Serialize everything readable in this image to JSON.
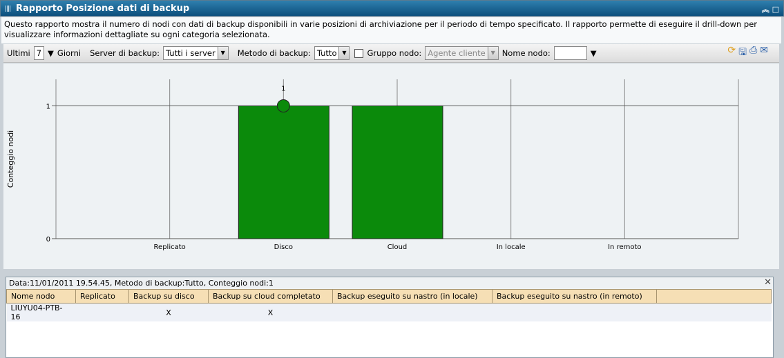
{
  "window": {
    "title": "Rapporto Posizione dati di backup",
    "collapse_icon": "double-chevron-up",
    "maximize_icon": "square"
  },
  "description": "Questo rapporto mostra il numero di nodi con dati di backup disponibili in varie posizioni di archiviazione per il periodo di tempo specificato. Il rapporto permette di eseguire il drill-down per visualizzare informazioni dettagliate su ogni categoria selezionata.",
  "filters": {
    "last_label": "Ultimi",
    "days_value": "7",
    "days_label": "Giorni",
    "server_label": "Server di backup:",
    "server_value": "Tutti i server",
    "method_label": "Metodo di backup:",
    "method_value": "Tutto",
    "group_label": "Gruppo nodo:",
    "group_value": "Agente cliente",
    "group_checked": false,
    "node_label": "Nome nodo:",
    "node_value": ""
  },
  "actions": [
    "refresh-icon",
    "save-icon",
    "print-icon",
    "email-icon"
  ],
  "chart_data": {
    "type": "bar",
    "categories": [
      "Replicato",
      "Disco",
      "Cloud",
      "In locale",
      "In remoto"
    ],
    "values": [
      0,
      1,
      1,
      0,
      0
    ],
    "ylabel": "Conteggio nodi",
    "xlabel": "",
    "yticks": [
      "0",
      "1"
    ],
    "ylim": [
      0,
      1.2
    ],
    "grid": true,
    "bar_color": "#0b8a0b",
    "selected_point": {
      "category": "Disco",
      "value": 1,
      "label": "1"
    }
  },
  "detail": {
    "header": "Data:11/01/2011 19.54.45, Metodo di backup:Tutto, Conteggio nodi:1",
    "columns": [
      "Nome nodo",
      "Replicato",
      "Backup su disco",
      "Backup su cloud completato",
      "Backup eseguito su nastro (in locale)",
      "Backup eseguito su nastro (in remoto)",
      ""
    ],
    "rows": [
      [
        "LIUYU04-PTB-16",
        "",
        "X",
        "X",
        "",
        "",
        ""
      ]
    ]
  }
}
